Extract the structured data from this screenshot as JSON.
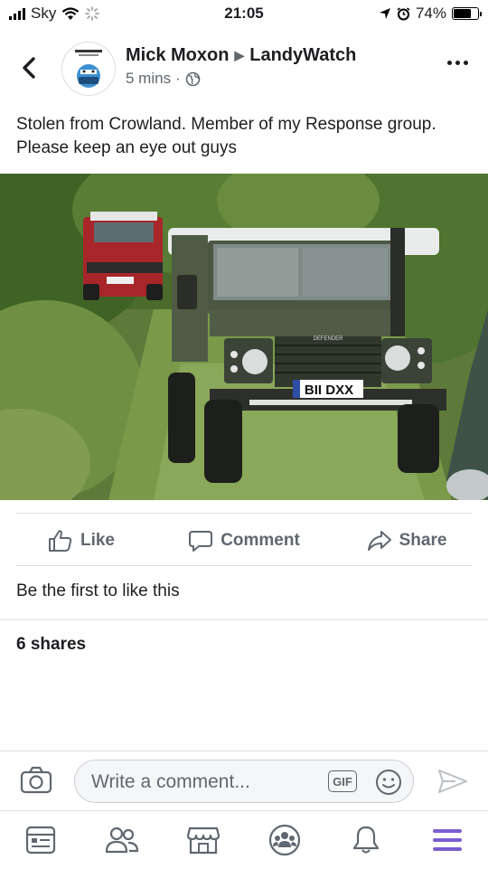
{
  "status_bar": {
    "carrier": "Sky",
    "time": "21:05",
    "battery_percent": "74%",
    "battery_level": 0.74
  },
  "post": {
    "author": "Mick Moxon",
    "group": "LandyWatch",
    "time_ago": "5 mins",
    "separator": "·",
    "privacy_icon": "globe-icon",
    "text": "Stolen from Crowland. Member of my Response group. Please keep an eye out guys",
    "photo": {
      "plate": "BII DXX",
      "grille_badge": "DEFENDER"
    }
  },
  "actions": {
    "like_label": "Like",
    "comment_label": "Comment",
    "share_label": "Share"
  },
  "reactions": {
    "likes_text": "Be the first to like this",
    "shares_text": "6 shares"
  },
  "composer": {
    "placeholder": "Write a comment...",
    "gif_label": "GIF"
  },
  "tabbar": {
    "active_color": "#7b5fcf",
    "icon_color": "#606770",
    "tabs": [
      "news-feed-icon",
      "friends-icon",
      "marketplace-icon",
      "groups-icon",
      "notifications-icon",
      "menu-icon"
    ]
  }
}
